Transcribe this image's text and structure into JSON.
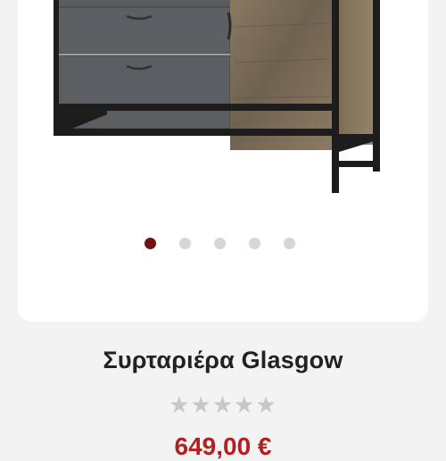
{
  "product": {
    "title": "Συρταριέρα Glasgow",
    "image_alt": "Glasgow chest of drawers product photo",
    "rating": {
      "value": 0,
      "max": 5,
      "star_glyph": "★"
    },
    "price_partial": "649,00 €"
  },
  "gallery": {
    "total_images": 5,
    "active_index": 0
  },
  "colors": {
    "background": "#f3f3f3",
    "card": "#ffffff",
    "dot_active": "#6e1414",
    "dot_inactive": "#d6d6d6",
    "star_empty": "#c7c7c7",
    "price": "#b02222"
  }
}
